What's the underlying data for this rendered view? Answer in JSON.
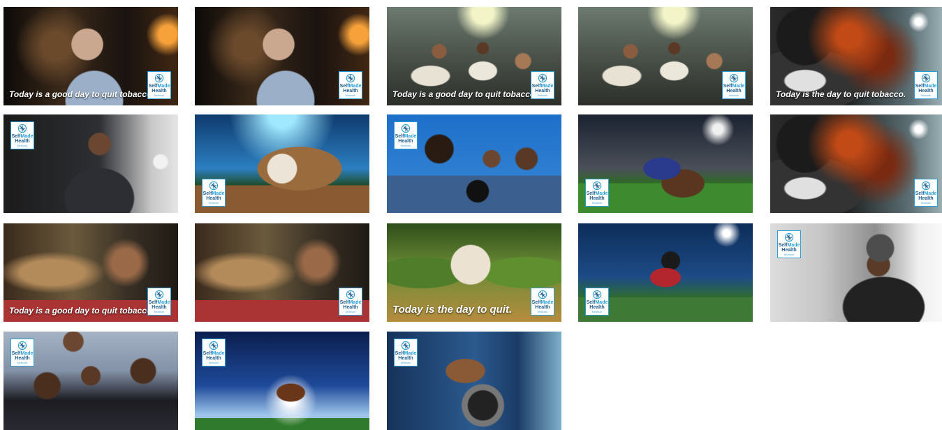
{
  "brand": {
    "line1_a": "Self",
    "line1_b": "Made",
    "line2": "Health",
    "line3": "Network",
    "logo_icon": "network-heart-icon",
    "accent_color": "#2a9fd6",
    "brand_color": "#1e5a8a"
  },
  "captions": {
    "good_day": "Today is a good day to quit tobacco.",
    "the_day": "Today is the day to quit tobacco.",
    "quit": "Today is the day to quit."
  },
  "tiles": [
    {
      "scene": "older-man-smiling-night",
      "caption": "good_day",
      "logo": "bottom-right"
    },
    {
      "scene": "older-man-smiling-night",
      "caption": "",
      "logo": "bottom-right"
    },
    {
      "scene": "friends-cheering-living-room",
      "caption": "good_day",
      "logo": "bottom-right"
    },
    {
      "scene": "friends-cheering-living-room",
      "caption": "",
      "logo": "bottom-right"
    },
    {
      "scene": "football-player-smoke-burst",
      "caption": "the_day",
      "logo": "bottom-right"
    },
    {
      "scene": "baseball-fan-in-stands",
      "caption": "",
      "logo": "top-left"
    },
    {
      "scene": "baseball-glove-stadium",
      "caption": "",
      "logo": "bottom-left"
    },
    {
      "scene": "family-cheering-blue",
      "caption": "",
      "logo": "top-left"
    },
    {
      "scene": "football-glove-field",
      "caption": "",
      "logo": "bottom-left"
    },
    {
      "scene": "football-player-smoke-burst",
      "caption": "",
      "logo": "bottom-right"
    },
    {
      "scene": "young-man-watching-game",
      "caption": "good_day",
      "logo": "bottom-right"
    },
    {
      "scene": "young-man-watching-game",
      "caption": "",
      "logo": "bottom-right"
    },
    {
      "scene": "baseball-in-corn",
      "caption": "quit",
      "logo": "bottom-right"
    },
    {
      "scene": "baseball-catcher-stadium",
      "caption": "",
      "logo": "bottom-left"
    },
    {
      "scene": "man-with-phone-window",
      "caption": "",
      "logo": "top-left"
    },
    {
      "scene": "group-of-friends-couch",
      "caption": "",
      "logo": "top-left"
    },
    {
      "scene": "football-on-field-lights",
      "caption": "",
      "logo": "top-left"
    },
    {
      "scene": "boot-on-truck-step",
      "caption": "",
      "logo": "top-left"
    }
  ]
}
